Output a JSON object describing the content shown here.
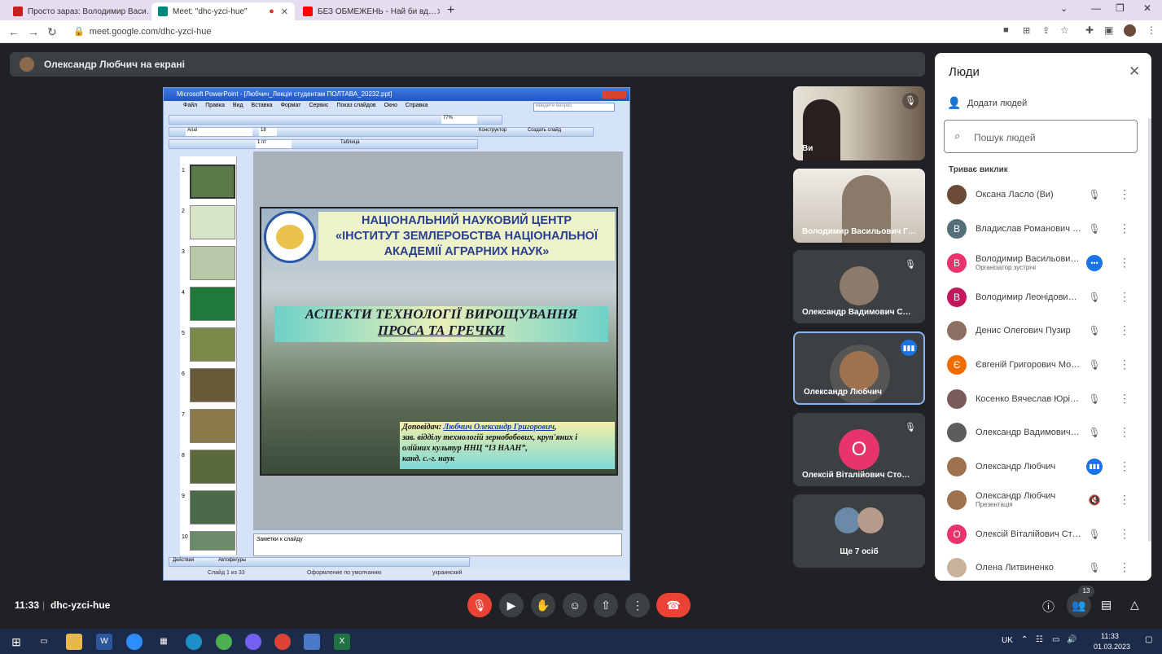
{
  "browser": {
    "tabs": [
      {
        "title": "Просто зараз: Володимир Васи…",
        "color": "#c5221f"
      },
      {
        "title": "Meet: \"dhc-yzci-hue\"",
        "color": "#00897b"
      },
      {
        "title": "БЕЗ ОБМЕЖЕНЬ - Най би вд…",
        "color": "#ff0000"
      }
    ],
    "url": "meet.google.com/dhc-yzci-hue"
  },
  "presentation_bar": {
    "title": "Олександр Любчич на екрані"
  },
  "powerpoint": {
    "window_title": "Microsoft PowerPoint - [Любчич_Лекція студентам ПОЛТАВА_20232.ppt]",
    "menu": [
      "Файл",
      "Правка",
      "Вид",
      "Вставка",
      "Формат",
      "Сервис",
      "Показ слайдов",
      "Окно",
      "Справка"
    ],
    "help_placeholder": "Введите вопрос",
    "zoom": "77%",
    "font": "Arial",
    "font_size": "18",
    "constructor": "Конструктор",
    "new_slide": "Создать слайд",
    "line_width": "1 пт",
    "table": "Таблица",
    "slide_numbers": [
      "1",
      "2",
      "3",
      "4",
      "5",
      "6",
      "7",
      "8",
      "9",
      "10"
    ],
    "slide": {
      "header_line1": "НАЦІОНАЛЬНИЙ НАУКОВИЙ ЦЕНТР",
      "header_line2": "«ІНСТИТУТ ЗЕМЛЕРОБСТВА НАЦІОНАЛЬНОЇ",
      "header_line3": "АКАДЕМІЇ АГРАРНИХ НАУК»",
      "topic_line1": "АСПЕКТИ ТЕХНОЛОГІЇ ВИРОЩУВАННЯ",
      "topic_line2": "ПРОСА ТА ГРЕЧКИ",
      "speaker_label": "Доповідач:",
      "speaker_name": "Любчич Олександр Григорович",
      "speaker_line2": "зав. відділу технологій зернобобових, круп'яних і",
      "speaker_line3": "олійних культур ННЦ “ІЗ НААН”,",
      "speaker_line4": "канд. с.-г. наук"
    },
    "notes": "Заметки к слайду",
    "draw_actions": "Действия",
    "autoshapes": "Автофигуры",
    "status": [
      "Слайд 1 из 33",
      "Оформление по умолчанию",
      "украинский"
    ]
  },
  "tiles": [
    {
      "name": "Ви"
    },
    {
      "name": "Володимир Васильович Г…"
    },
    {
      "name": "Олександр Вадимович С…"
    },
    {
      "name": "Олександр Любчич"
    },
    {
      "name": "Олексій Віталійович Сто…",
      "initial": "О",
      "color": "#e8336c"
    },
    {
      "name": "Ще 7 осіб"
    }
  ],
  "people": {
    "title": "Люди",
    "add": "Додати людей",
    "search_placeholder": "Пошук людей",
    "section": "Триває виклик",
    "list": [
      {
        "name": "Оксана Ласло (Ви)",
        "initial": "",
        "color": "#6a4b3a"
      },
      {
        "name": "Владислав Романович С…",
        "initial": "В",
        "color": "#546e7a"
      },
      {
        "name": "Володимир Васильович …",
        "sub": "Організатор зустрічі",
        "initial": "В",
        "color": "#e8336c"
      },
      {
        "name": "Володимир Леонідович …",
        "initial": "В",
        "color": "#c2185b"
      },
      {
        "name": "Денис Олегович Пузир",
        "initial": "",
        "color": "#8d6e63"
      },
      {
        "name": "Євгеній Григорович Мос…",
        "initial": "Є",
        "color": "#ef6c00"
      },
      {
        "name": "Косенко Вячеслав Юрій…",
        "initial": "",
        "color": "#7b5a5a"
      },
      {
        "name": "Олександр Вадимович …",
        "initial": "",
        "color": "#5d5d5d"
      },
      {
        "name": "Олександр Любчич",
        "initial": "",
        "color": "#a0714f"
      },
      {
        "name": "Олександр Любчич",
        "sub": "Презентація",
        "initial": "",
        "color": "#a0714f"
      },
      {
        "name": "Олексій Віталійович Сто…",
        "initial": "О",
        "color": "#e8336c"
      },
      {
        "name": "Олена Литвиненко",
        "initial": "",
        "color": "#c9b29a"
      }
    ]
  },
  "meeting": {
    "time": "11:33",
    "code": "dhc-yzci-hue",
    "people_count": "13"
  },
  "taskbar": {
    "lang": "UK",
    "time": "11:33",
    "date": "01.03.2023"
  }
}
